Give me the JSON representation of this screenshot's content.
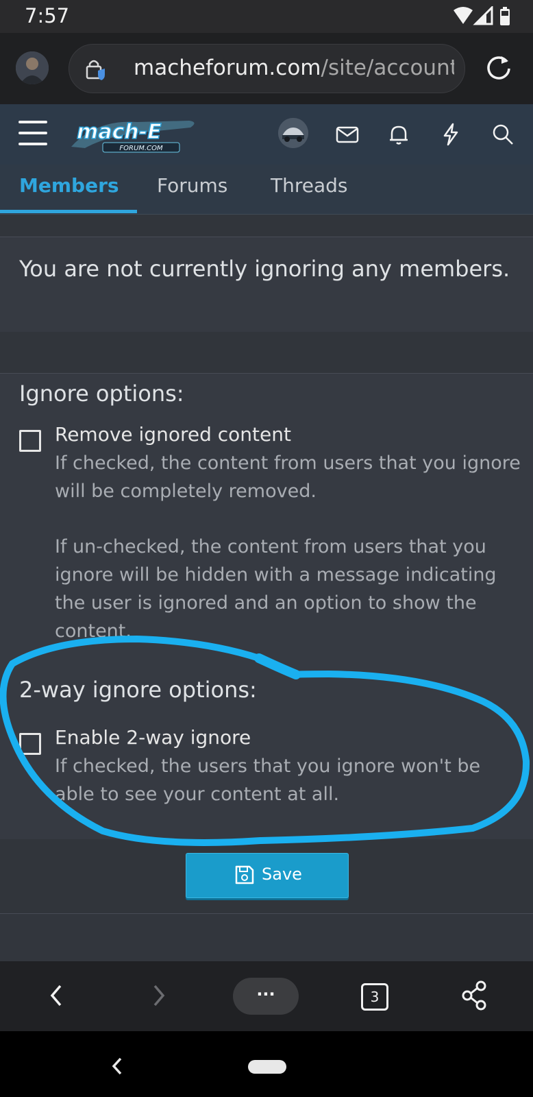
{
  "status_bar": {
    "time": "7:57"
  },
  "browser": {
    "url_host": "macheforum.com",
    "url_path": "/site/account",
    "open_tab_count": "3",
    "menu_label": "···"
  },
  "site_header": {
    "logo_text": "mach-E",
    "logo_subtext": "FORUM.COM"
  },
  "tabs": [
    {
      "label": "Members",
      "active": true
    },
    {
      "label": "Forums",
      "active": false
    },
    {
      "label": "Threads",
      "active": false
    }
  ],
  "notice": "You are not currently ignoring any members.",
  "ignore_options": {
    "title": "Ignore options:",
    "remove_ignored": {
      "label": "Remove ignored content",
      "checked": false,
      "hint_1": "If checked, the content from users that you ignore will be completely removed.",
      "hint_2": "If un-checked, the content from users that you ignore will be hidden with a message indicating the user is ignored and an option to show the content."
    }
  },
  "two_way_options": {
    "title": "2-way ignore options:",
    "enable_two_way": {
      "label": "Enable 2-way ignore",
      "checked": false,
      "hint": "If checked, the users that you ignore won't be able to see your content at all."
    }
  },
  "save_label": "Save",
  "colors": {
    "accent": "#2fa6de",
    "button": "#1a9ccb",
    "annotation": "#1ab0f0",
    "header": "#2d3a49"
  }
}
